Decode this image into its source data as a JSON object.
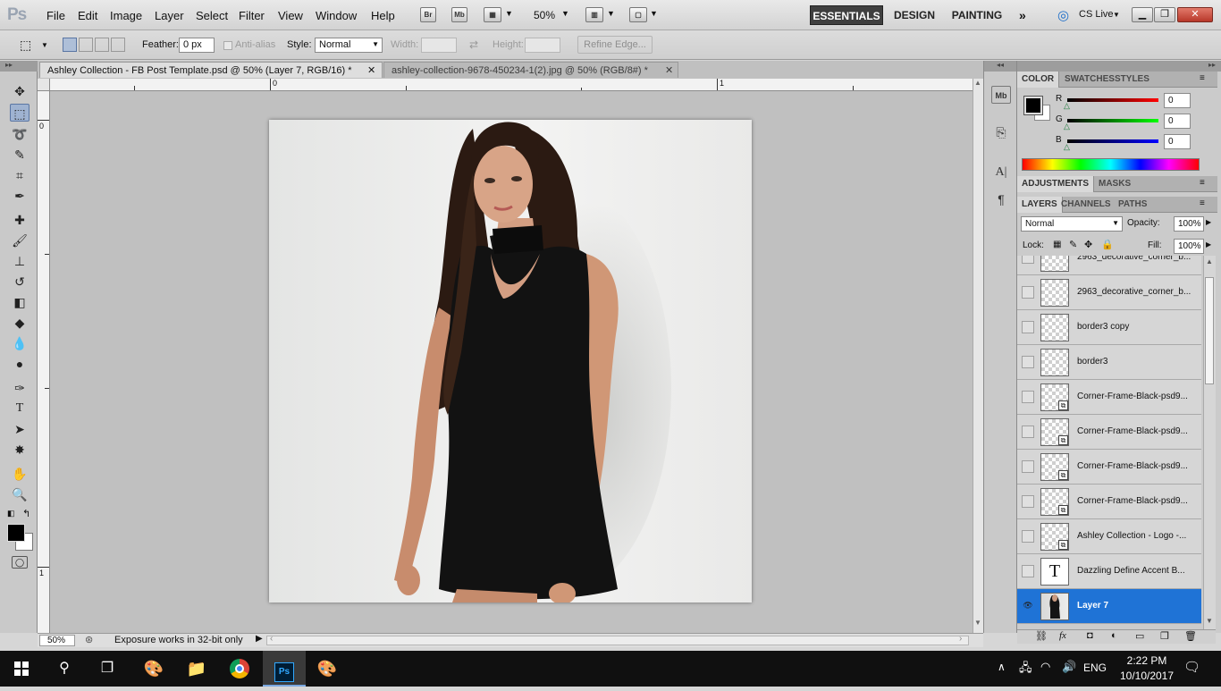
{
  "app": {
    "logo": "Ps"
  },
  "menu": [
    "File",
    "Edit",
    "Image",
    "Layer",
    "Select",
    "Filter",
    "View",
    "Window",
    "Help"
  ],
  "appbar": {
    "br": "Br",
    "mb": "Mb",
    "zoom": "50%"
  },
  "workspaces": [
    "ESSENTIALS",
    "DESIGN",
    "PAINTING"
  ],
  "cslive": "CS Live",
  "options": {
    "feather_label": "Feather:",
    "feather_value": "0 px",
    "antialias_label": "Anti-alias",
    "style_label": "Style:",
    "style_value": "Normal",
    "width_label": "Width:",
    "height_label": "Height:",
    "refine_edge": "Refine Edge..."
  },
  "tabs": [
    {
      "label": "Ashley Collection - FB Post Template.psd @ 50% (Layer 7, RGB/16) *"
    },
    {
      "label": "ashley-collection-9678-450234-1(2).jpg @ 50% (RGB/8#) *"
    }
  ],
  "rulers": {
    "top": [
      "0",
      "1"
    ],
    "left": [
      "0",
      "1"
    ]
  },
  "status": {
    "zoom": "50%",
    "message": "Exposure works in 32-bit only"
  },
  "color_panel": {
    "tabs": [
      "COLOR",
      "SWATCHES",
      "STYLES"
    ],
    "channels": [
      {
        "label": "R",
        "value": "0"
      },
      {
        "label": "G",
        "value": "0"
      },
      {
        "label": "B",
        "value": "0"
      }
    ]
  },
  "adjustments_panel": {
    "tabs": [
      "ADJUSTMENTS",
      "MASKS"
    ]
  },
  "layers_panel": {
    "tabs": [
      "LAYERS",
      "CHANNELS",
      "PATHS"
    ],
    "blend_mode": "Normal",
    "opacity_label": "Opacity:",
    "opacity": "100%",
    "lock_label": "Lock:",
    "fill_label": "Fill:",
    "fill": "100%",
    "layers": [
      {
        "name": "2963_decorative_corner_b...",
        "kind": "pixel"
      },
      {
        "name": "2963_decorative_corner_b...",
        "kind": "pixel"
      },
      {
        "name": "border3 copy",
        "kind": "pixel"
      },
      {
        "name": "border3",
        "kind": "pixel"
      },
      {
        "name": "Corner-Frame-Black-psd9...",
        "kind": "smart"
      },
      {
        "name": "Corner-Frame-Black-psd9...",
        "kind": "smart"
      },
      {
        "name": "Corner-Frame-Black-psd9...",
        "kind": "smart"
      },
      {
        "name": "Corner-Frame-Black-psd9...",
        "kind": "smart"
      },
      {
        "name": "Ashley Collection - Logo -...",
        "kind": "smart"
      },
      {
        "name": "Dazzling Define  Accent B...",
        "kind": "text",
        "thumb_glyph": "T"
      },
      {
        "name": "Layer 7",
        "kind": "photo",
        "selected": true,
        "visible": true
      }
    ]
  },
  "taskbar": {
    "time": "2:22 PM",
    "date": "10/10/2017",
    "language": "ENG"
  },
  "colors": {
    "accent": "#1f73d6",
    "workspace_active": "#3f3f3f",
    "taskbar": "#101010"
  }
}
